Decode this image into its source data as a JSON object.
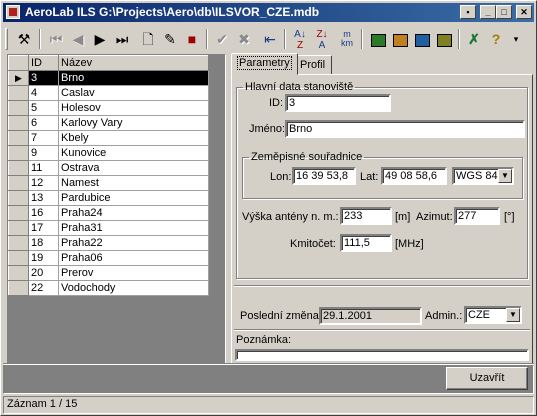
{
  "window": {
    "title": "AeroLab ILS G:\\Projects\\Aero\\db\\ILSVOR_CZE.mdb"
  },
  "grid": {
    "headers": [
      "ID",
      "Název"
    ],
    "rows": [
      {
        "id": "3",
        "name": "Brno"
      },
      {
        "id": "4",
        "name": "Caslav"
      },
      {
        "id": "5",
        "name": "Holesov"
      },
      {
        "id": "6",
        "name": "Karlovy Vary"
      },
      {
        "id": "7",
        "name": "Kbely"
      },
      {
        "id": "9",
        "name": "Kunovice"
      },
      {
        "id": "11",
        "name": "Ostrava"
      },
      {
        "id": "12",
        "name": "Namest"
      },
      {
        "id": "13",
        "name": "Pardubice"
      },
      {
        "id": "16",
        "name": "Praha24"
      },
      {
        "id": "17",
        "name": "Praha31"
      },
      {
        "id": "18",
        "name": "Praha22"
      },
      {
        "id": "19",
        "name": "Praha06"
      },
      {
        "id": "20",
        "name": "Prerov"
      },
      {
        "id": "22",
        "name": "Vodochody"
      }
    ]
  },
  "tabs": {
    "parametry": "Parametry",
    "profil": "Profil"
  },
  "form": {
    "main_group": "Hlavní data stanoviště",
    "id_label": "ID:",
    "id_value": "3",
    "name_label": "Jméno:",
    "name_value": "Brno",
    "coords_group": "Zeměpisné souřadnice",
    "lon_label": "Lon:",
    "lon_value": "16 39 53,8",
    "lat_label": "Lat:",
    "lat_value": "49 08 58,6",
    "datum_value": "WGS 84",
    "height_label": "Výška antény  n. m.:",
    "height_value": "233",
    "height_unit": "[m]",
    "azimuth_label": "Azimut:",
    "azimuth_value": "277",
    "azimuth_unit": "[°]",
    "freq_label": "Kmitočet:",
    "freq_value": "111,5",
    "freq_unit": "[MHz]",
    "last_change_label": "Poslední změna:",
    "last_change_value": "29.1.2001",
    "admin_label": "Admin.:",
    "admin_value": "CZE",
    "note_label": "Poznámka:",
    "note_value": ""
  },
  "close_button": "Uzavřít",
  "status": "Záznam 1 / 15",
  "icons": [
    "tools-icon",
    "first-record-icon",
    "prev-record-icon",
    "next-record-icon",
    "last-record-icon",
    "new-record-icon",
    "edit-record-icon",
    "delete-record-icon",
    "confirm-icon",
    "cancel-icon",
    "refresh-icon",
    "sort-ascending-icon",
    "sort-descending-icon",
    "units-icon",
    "map1-icon",
    "map2-icon",
    "map3-icon",
    "map4-icon",
    "excel-icon",
    "help-icon"
  ],
  "units_icon_text": {
    "top": "m",
    "bottom": "km"
  }
}
